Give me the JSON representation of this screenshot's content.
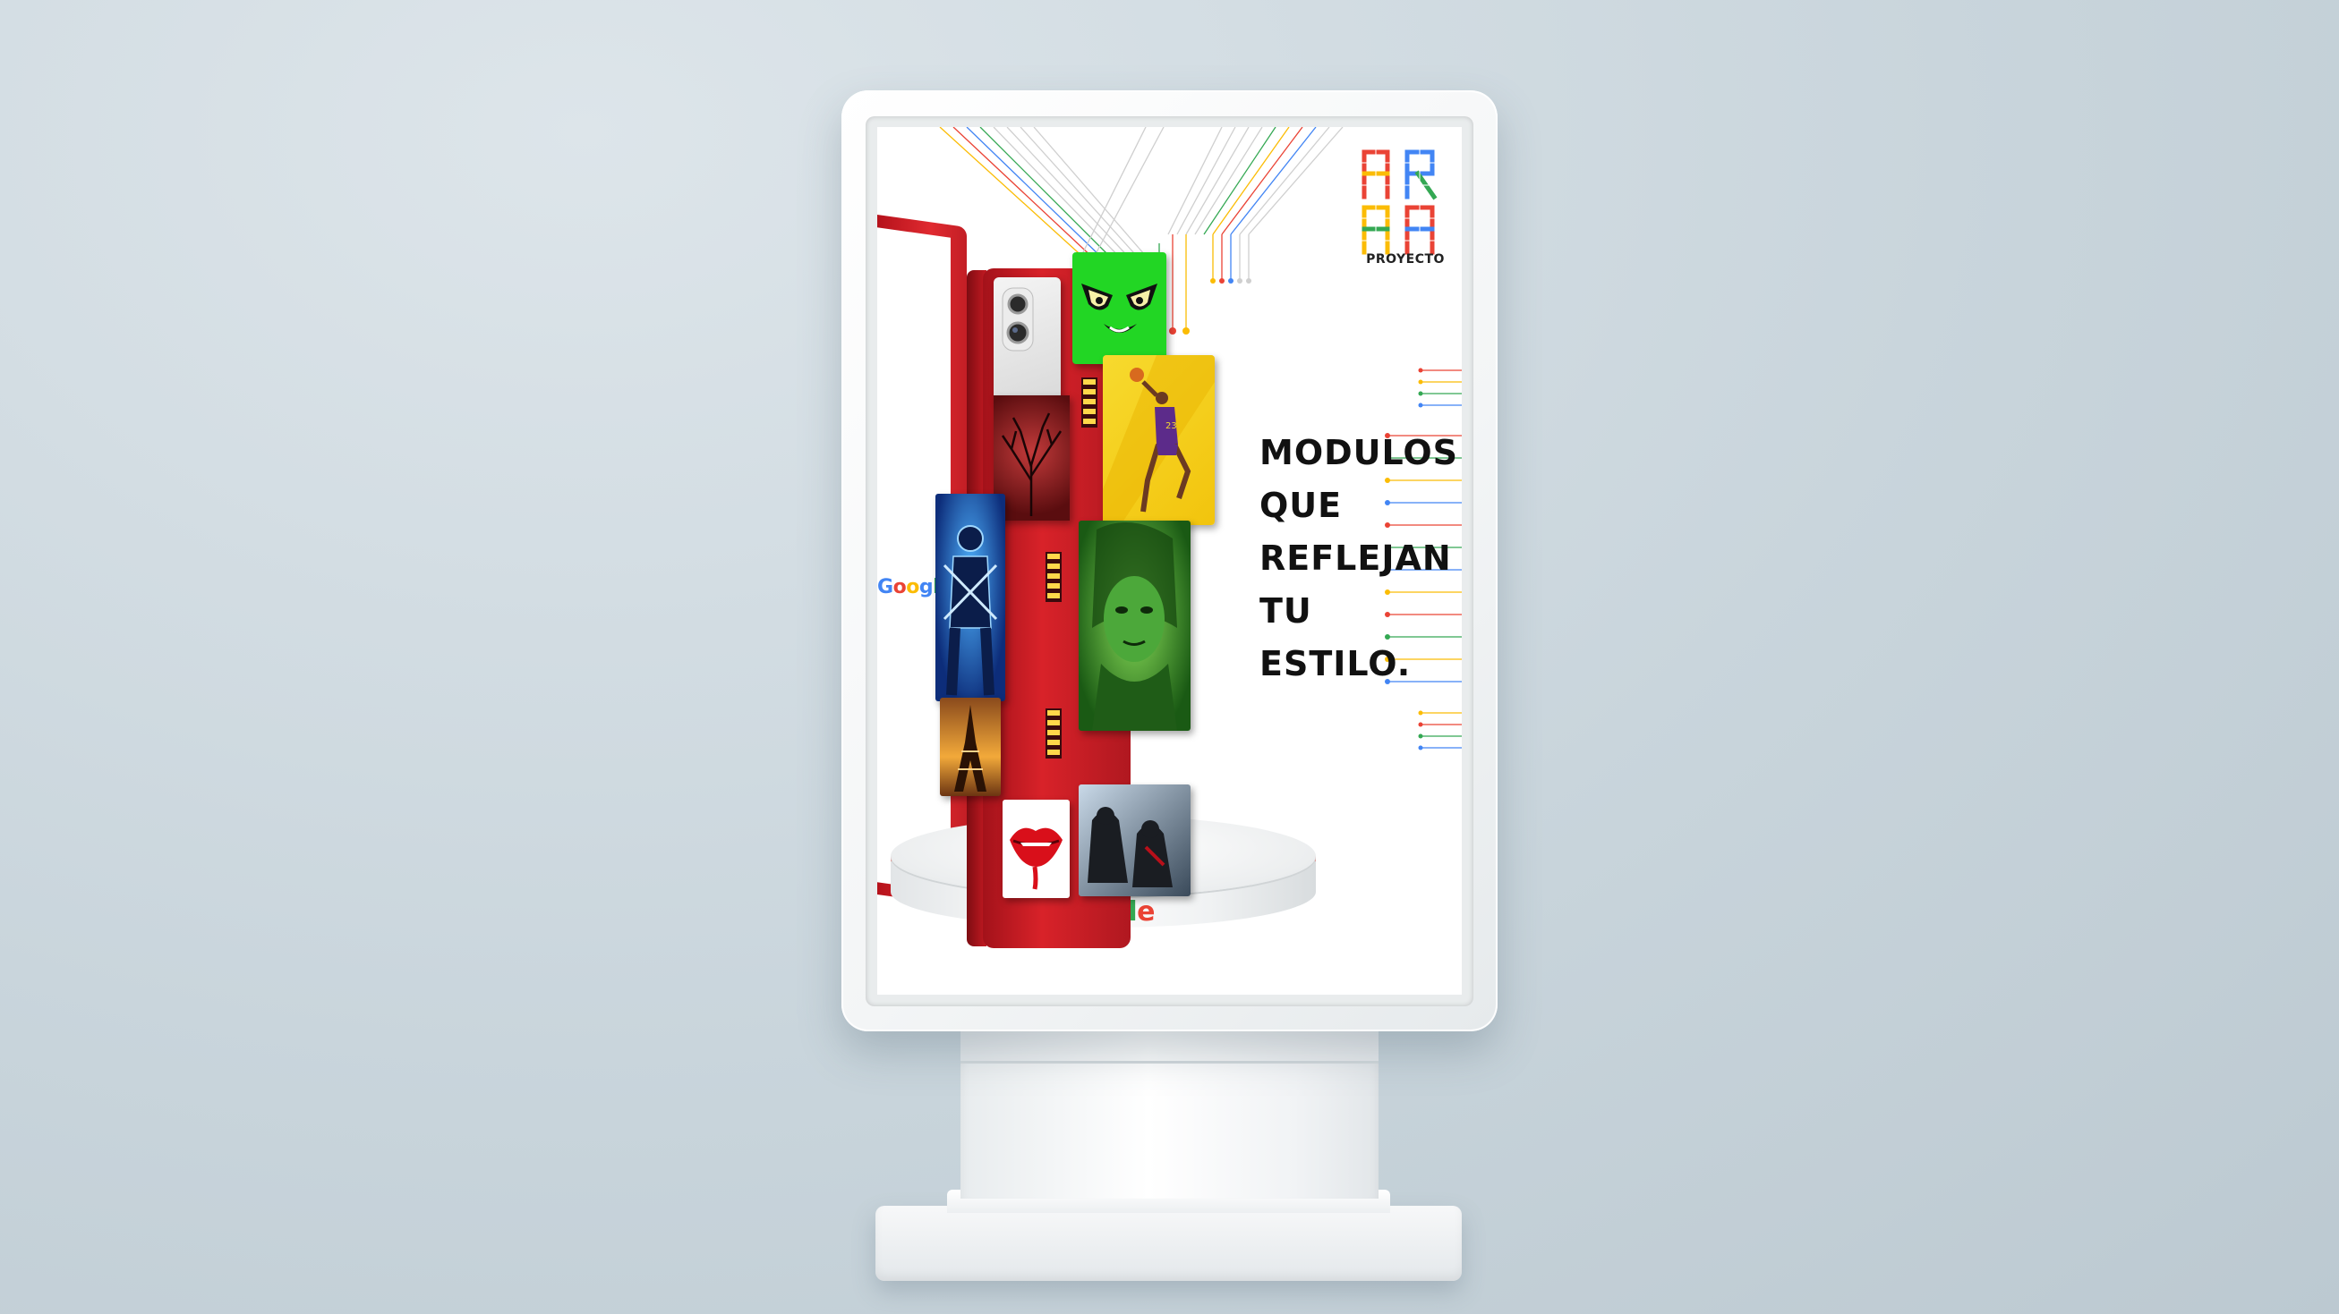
{
  "poster": {
    "brand": {
      "logo_letters": "ARA",
      "subtitle": "PROYECTO"
    },
    "headline": [
      "MODULOS",
      "QUE",
      "REFLEJAN",
      "TU",
      "ESTILO."
    ],
    "google_side_label": "Google",
    "google_podium_label": "Google",
    "google_letters": [
      {
        "ch": "G",
        "color": "#4285F4"
      },
      {
        "ch": "o",
        "color": "#EA4335"
      },
      {
        "ch": "o",
        "color": "#FBBC05"
      },
      {
        "ch": "g",
        "color": "#4285F4"
      },
      {
        "ch": "l",
        "color": "#34A853"
      },
      {
        "ch": "e",
        "color": "#EA4335"
      }
    ],
    "colors": {
      "phone_red": "#D82229",
      "google_blue": "#4285F4",
      "google_red": "#EA4335",
      "google_yellow": "#FBBC05",
      "google_green": "#34A853",
      "background": "#C9D5DC"
    },
    "modules": [
      {
        "name": "camera-module",
        "subject": "camera-icon"
      },
      {
        "name": "alien-face-module",
        "subject": "alien-face-icon"
      },
      {
        "name": "tree-module",
        "subject": "tree-icon"
      },
      {
        "name": "basketball-player-module",
        "subject": "basketball-player-icon"
      },
      {
        "name": "blue-warrior-module",
        "subject": "warrior-icon"
      },
      {
        "name": "green-portrait-module",
        "subject": "portrait-icon"
      },
      {
        "name": "eiffel-tower-module",
        "subject": "eiffel-tower-icon"
      },
      {
        "name": "red-lips-module",
        "subject": "lips-icon"
      },
      {
        "name": "dark-scene-module",
        "subject": "figures-icon"
      }
    ]
  }
}
